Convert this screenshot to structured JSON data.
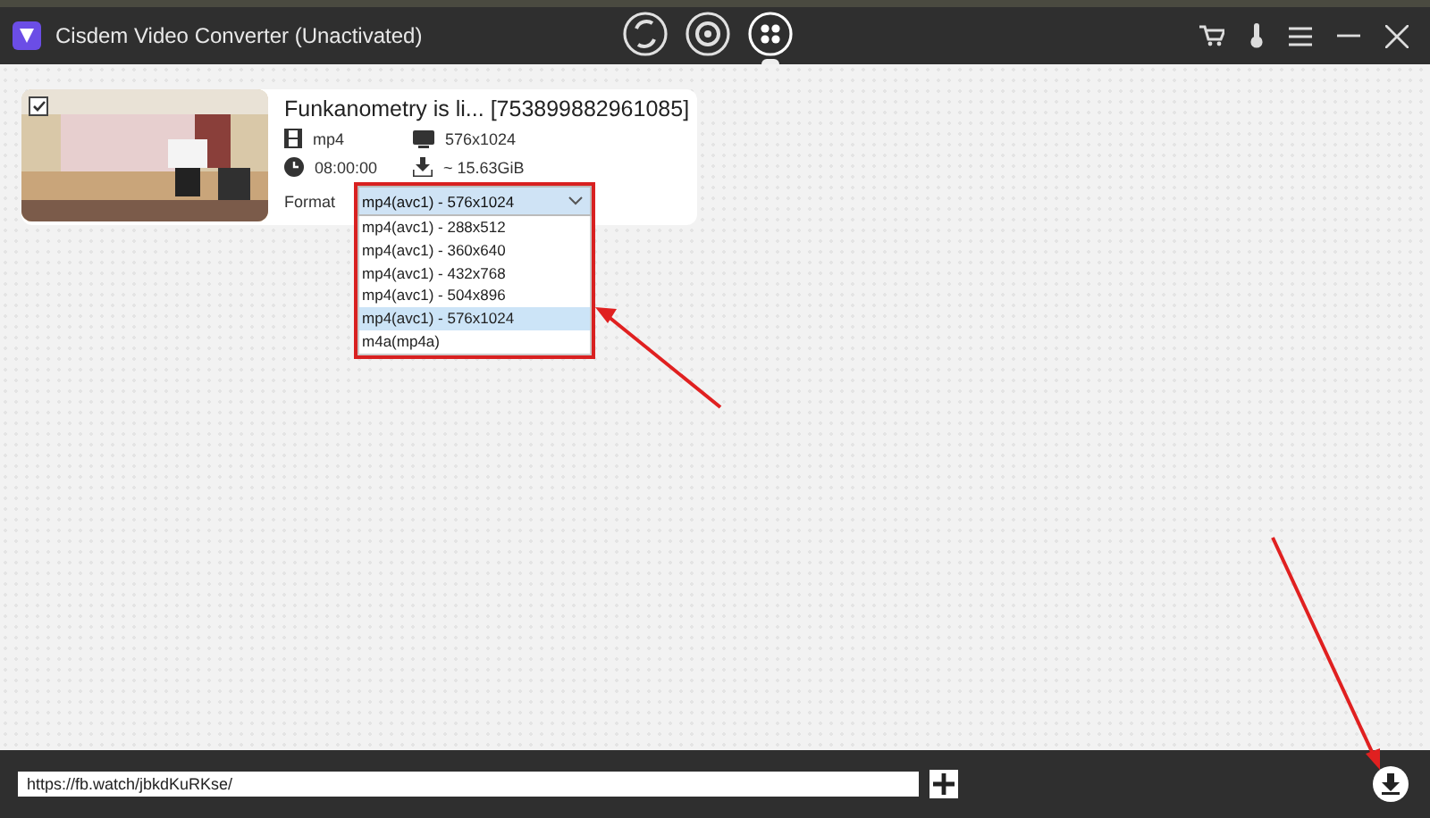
{
  "window": {
    "title": "Cisdem Video Converter (Unactivated)"
  },
  "mode_tabs": [
    {
      "selected": false
    },
    {
      "selected": false
    },
    {
      "selected": true
    }
  ],
  "video": {
    "checked": true,
    "title": "Funkanometry is li... [753899882961085]",
    "container": "mp4",
    "resolution": "576x1024",
    "duration": "08:00:00",
    "size": "~ 15.63GiB",
    "format_label": "Format",
    "format_value": "mp4(avc1) - 576x1024",
    "format_options": [
      {
        "label": "mp4(avc1) - 288x512",
        "selected": false
      },
      {
        "label": "mp4(avc1) - 360x640",
        "selected": false
      },
      {
        "label": "mp4(avc1) - 432x768",
        "selected": false
      },
      {
        "label": "mp4(avc1) - 504x896",
        "selected": false
      },
      {
        "label": "mp4(avc1) - 576x1024",
        "selected": true
      },
      {
        "label": "m4a(mp4a)",
        "selected": false
      }
    ]
  },
  "url_field": {
    "value": "https://fb.watch/jbkdKuRKse/"
  }
}
